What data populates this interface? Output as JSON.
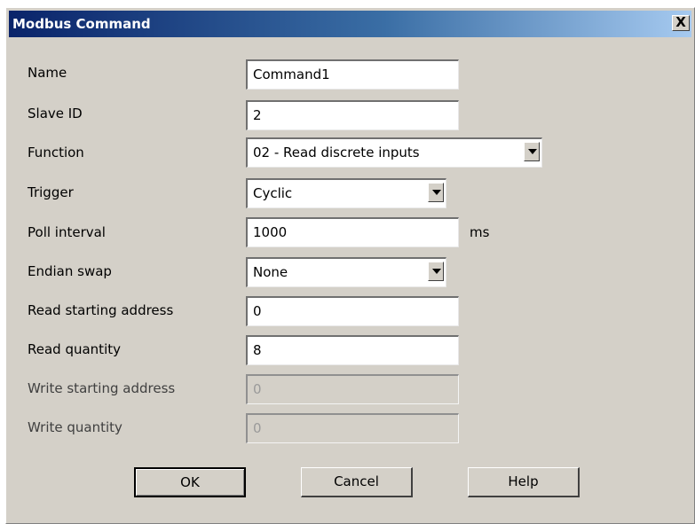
{
  "window": {
    "title": "Modbus Command",
    "close_glyph": "X"
  },
  "form": {
    "name": {
      "label": "Name",
      "value": "Command1"
    },
    "slave_id": {
      "label": "Slave ID",
      "value": "2"
    },
    "function": {
      "label": "Function",
      "value": "02 - Read discrete inputs"
    },
    "trigger": {
      "label": "Trigger",
      "value": "Cyclic"
    },
    "poll_interval": {
      "label": "Poll interval",
      "value": "1000",
      "unit": "ms"
    },
    "endian_swap": {
      "label": "Endian swap",
      "value": "None"
    },
    "read_start": {
      "label": "Read starting address",
      "value": "0"
    },
    "read_qty": {
      "label": "Read quantity",
      "value": "8"
    },
    "write_start": {
      "label": "Write starting address",
      "value": "0",
      "disabled": true
    },
    "write_qty": {
      "label": "Write quantity",
      "value": "0",
      "disabled": true
    }
  },
  "buttons": {
    "ok": "OK",
    "cancel": "Cancel",
    "help": "Help"
  },
  "colors": {
    "dialog_bg": "#d4d0c8",
    "title_start": "#0a246a",
    "title_end": "#a6caf0"
  }
}
